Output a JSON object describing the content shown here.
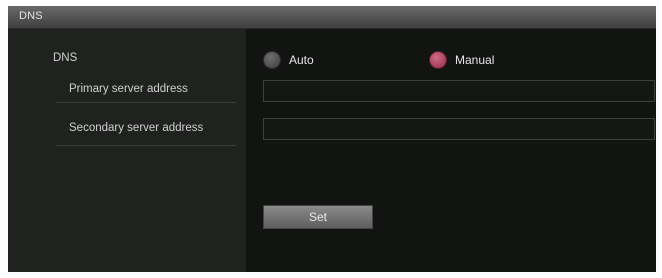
{
  "window": {
    "title": "DNS"
  },
  "dns": {
    "label": "DNS",
    "options": [
      {
        "label": "Auto",
        "selected": false
      },
      {
        "label": "Manual",
        "selected": true
      }
    ],
    "selected_color": "#b03a5c",
    "unselected_color": "#555555"
  },
  "primary": {
    "label": "Primary server address",
    "value": ""
  },
  "secondary": {
    "label": "Secondary server address",
    "value": ""
  },
  "set_button": {
    "label": "Set"
  }
}
